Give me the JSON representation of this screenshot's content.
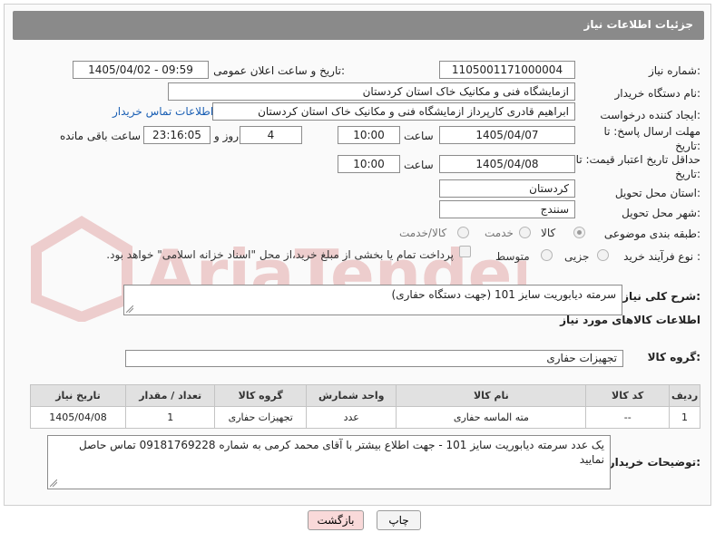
{
  "header": {
    "title": "جزئیات اطلاعات نیاز"
  },
  "fields": {
    "need_number_label": "شماره نیاز:",
    "need_number": "1105001171000004",
    "announce_label": "تاریخ و ساعت اعلان عمومی:",
    "announce_value": "1405/04/02 - 09:59",
    "buyer_org_label": "نام دستگاه خریدار:",
    "buyer_org": "ازمایشگاه فنی و مکانیک خاک استان کردستان",
    "creator_label": "ایجاد کننده درخواست:",
    "creator": "ابراهیم قادری کارپرداز ازمایشگاه فنی و مکانیک خاک استان کردستان",
    "contact_link": "اطلاعات تماس خریدار",
    "deadline_label": "مهلت ارسال پاسخ: تا تاریخ:",
    "deadline_date": "1405/04/07",
    "time_label": "ساعت",
    "deadline_time": "10:00",
    "days": "4",
    "days_label": "روز و",
    "remaining": "23:16:05",
    "remaining_label": "ساعت باقی مانده",
    "price_validity_label": "حداقل تاریخ اعتبار قیمت: تا تاریخ:",
    "price_date": "1405/04/08",
    "price_time": "10:00",
    "province_label": "استان محل تحویل:",
    "province": "کردستان",
    "city_label": "شهر محل تحویل:",
    "city": "سنندج",
    "category_label": "طبقه بندی موضوعی:",
    "category_options": [
      "کالا",
      "خدمت",
      "کالا/خدمت"
    ],
    "process_label": "نوع فرآیند خرید :",
    "process_options": [
      "جزیی",
      "متوسط"
    ],
    "payment_note": "پرداخت تمام یا بخشی از مبلغ خرید،از محل \"اسناد خزانه اسلامی\" خواهد بود."
  },
  "summary": {
    "label": "شرح کلی نیاز:",
    "value": "سرمته دیابوریت سایز 101 (جهت دستگاه حفاری)"
  },
  "goods": {
    "section_title": "اطلاعات کالاهای مورد نیاز",
    "group_label": "گروه کالا:",
    "group_value": "تجهیزات حفاری",
    "columns": [
      "ردیف",
      "کد کالا",
      "نام کالا",
      "واحد شمارش",
      "گروه کالا",
      "تعداد / مقدار",
      "تاریخ نیاز"
    ],
    "rows": [
      {
        "row": "1",
        "code": "--",
        "name": "مته الماسه حفاری",
        "unit": "عدد",
        "group": "تجهیزات حفاری",
        "qty": "1",
        "date": "1405/04/08"
      }
    ]
  },
  "buyer_notes": {
    "label": "توضیحات خریدار:",
    "value": "یک عدد سرمته دیابوریت سایز 101 - جهت اطلاع بیشتر با آقای محمد کرمی به شماره 09181769228 تماس حاصل نمایید"
  },
  "buttons": {
    "print": "چاپ",
    "back": "بازگشت"
  },
  "watermark_text": "AriaTender.net",
  "colors": {
    "header_bg": "#8a8a8a",
    "link": "#1a5fb4",
    "back_button_bg": "#f9d9d9"
  }
}
